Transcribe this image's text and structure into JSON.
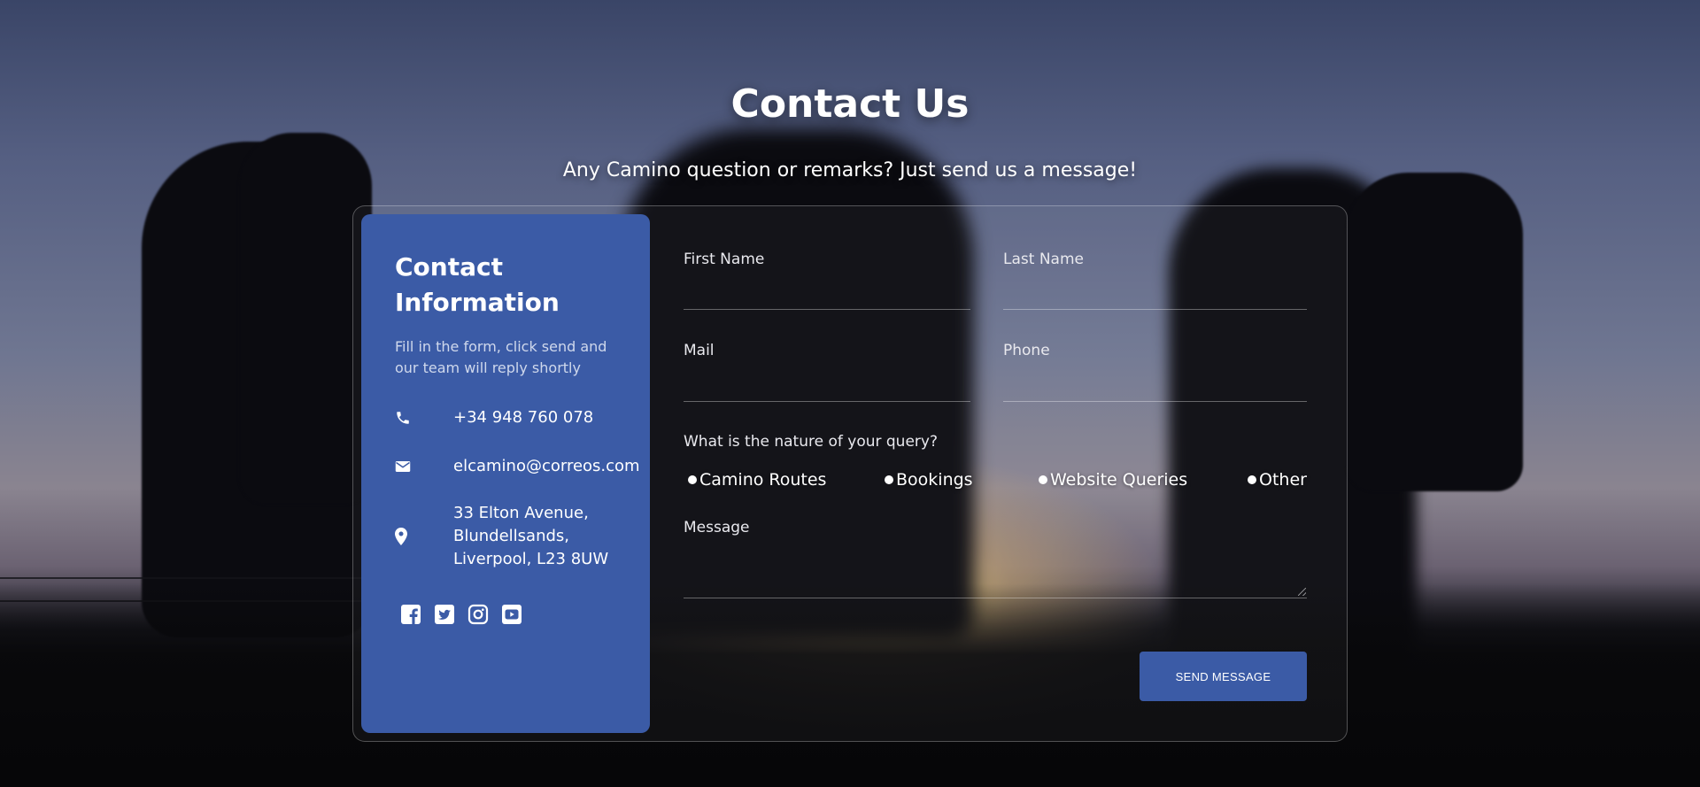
{
  "hero": {
    "title": "Contact Us",
    "subtitle": "Any Camino question or remarks? Just send us a message!"
  },
  "info": {
    "heading": "Contact Information",
    "description": "Fill in the form, click send and our team will reply shortly",
    "phone": "+34 948 760 078",
    "email": "elcamino@correos.com",
    "address": "33 Elton Avenue, Blundellsands, Liverpool, L23 8UW",
    "socials": [
      "facebook-icon",
      "twitter-icon",
      "instagram-icon",
      "youtube-icon"
    ]
  },
  "form": {
    "first_name_label": "First Name",
    "last_name_label": "Last Name",
    "mail_label": "Mail",
    "phone_label": "Phone",
    "query_label": "What is the nature of your query?",
    "options": [
      "Camino Routes",
      "Bookings",
      "Website Queries",
      "Other"
    ],
    "message_label": "Message",
    "send_label": "SEND MESSAGE"
  },
  "colors": {
    "accent": "#3b5ba6"
  }
}
